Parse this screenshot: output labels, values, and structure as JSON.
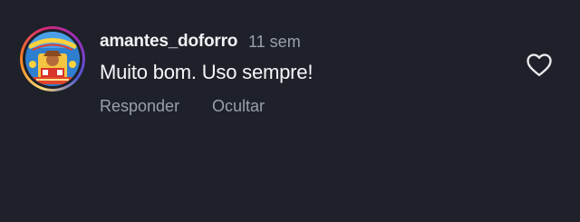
{
  "comment": {
    "username": "amantes_doforro",
    "time": "11 sem",
    "text": "Muito bom. Uso sempre!",
    "actions": {
      "reply": "Responder",
      "hide": "Ocultar"
    },
    "avatar_icon": "profile-photo-avatar",
    "like_icon": "heart-outline-icon"
  },
  "colors": {
    "background": "#1e212a",
    "primary_text": "#f1f2f4",
    "secondary_text": "#9aa0a8"
  }
}
